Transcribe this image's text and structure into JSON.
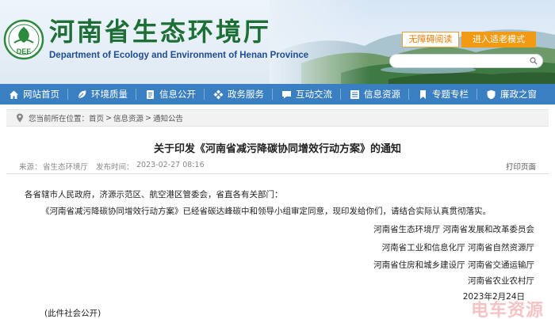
{
  "header": {
    "site_title": "河南省生态环境厅",
    "site_subtitle": "Department of Ecology and Environment of Henan Province",
    "logo_text": "DEE",
    "accessible_label": "无障碍阅读",
    "elder_mode_label": "进入适老模式",
    "search_placeholder": ""
  },
  "nav": {
    "items": [
      {
        "label": "网站首页",
        "icon": "home-icon"
      },
      {
        "label": "环境质量",
        "icon": "leaf-icon"
      },
      {
        "label": "信息公开",
        "icon": "document-icon"
      },
      {
        "label": "政务服务",
        "icon": "diamond-grid-icon"
      },
      {
        "label": "互动交流",
        "icon": "chat-icon"
      },
      {
        "label": "信息资源",
        "icon": "list-icon"
      },
      {
        "label": "专题专栏",
        "icon": "bookmark-icon"
      },
      {
        "label": "廉政之窗",
        "icon": "shield-icon"
      }
    ]
  },
  "breadcrumb": {
    "prefix": "您当前所在位置：",
    "items": [
      "首页",
      "信息资源",
      "通知公告"
    ],
    "separator": ">"
  },
  "article": {
    "title": "关于印发《河南省减污降碳协同增效行动方案》的通知",
    "source_label": "来源：",
    "source": "省生态环境厅",
    "time_label": "发布时间：",
    "time": "2023-02-27 08:16",
    "print_label": "打印页面",
    "salutation": "各省辖市人民政府，济源示范区、航空港区管委会，省直各有关部门：",
    "body": "《河南省减污降碳协同增效行动方案》已经省碳达峰碳中和领导小组审定同意，现印发给你们，请结合实际认真贯彻落实。",
    "signatories": [
      "河南省生态环境厅 河南省发展和改革委员会",
      "河南省工业和信息化厅 河南省自然资源厅",
      "河南省住房和城乡建设厅 河南省交通运输厅",
      "河南省农业农村厅"
    ],
    "date": "2023年2月24日",
    "disclosure": "(此件社会公开)"
  },
  "watermark": "电车资源",
  "colors": {
    "nav_bg": "#3a7fc1",
    "title_green": "#1d6f36",
    "subtitle_blue": "#1e4c9a",
    "elder_btn": "#f29a14"
  }
}
